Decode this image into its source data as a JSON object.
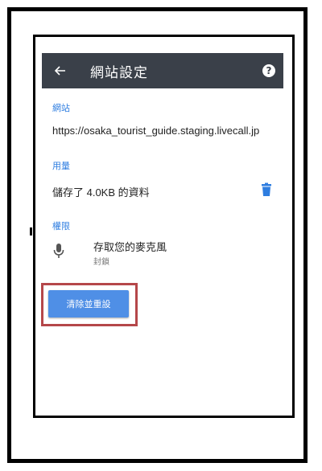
{
  "toolbar": {
    "title": "網站設定",
    "back_icon": "arrow-back-icon",
    "help_icon": "help-circle-icon",
    "help_glyph": "?",
    "background": "#3a4049"
  },
  "site_section": {
    "label": "網站",
    "url": "https://osaka_tourist_guide.staging.livecall.jp"
  },
  "usage_section": {
    "label": "用量",
    "stored_text": "儲存了 4.0KB 的資料",
    "delete_icon": "trash-icon"
  },
  "permissions_section": {
    "label": "權限",
    "items": [
      {
        "icon": "microphone-icon",
        "title": "存取您的麥克風",
        "status": "封鎖"
      }
    ]
  },
  "reset_button": {
    "label": "清除並重設",
    "color": "#4f8fe6"
  },
  "colors": {
    "accent": "#2e7de0",
    "highlight": "#b5474a"
  }
}
